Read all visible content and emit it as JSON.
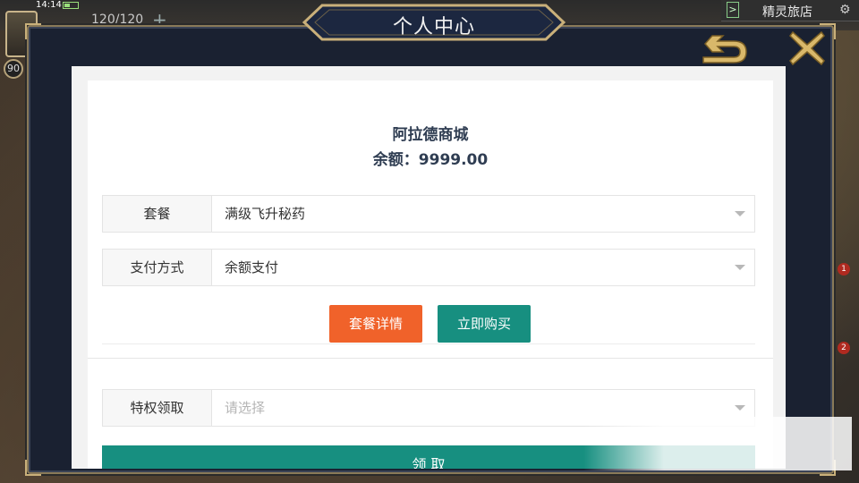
{
  "hud": {
    "time": "14:14",
    "energy": "120/120",
    "level": "90",
    "shop_label": "精灵旅店",
    "side_badge_1": "1",
    "side_badge_2": "2"
  },
  "dialog": {
    "title": "个人中心"
  },
  "shop": {
    "name": "阿拉德商城",
    "balance_label": "余额：",
    "balance_value": "9999.00"
  },
  "form": {
    "package": {
      "label": "套餐",
      "value": "满级飞升秘药"
    },
    "payment": {
      "label": "支付方式",
      "value": "余额支付"
    },
    "privilege": {
      "label": "特权领取",
      "placeholder": "请选择"
    }
  },
  "buttons": {
    "package_detail": "套餐详情",
    "buy_now": "立即购买",
    "claim": "领 取"
  },
  "colors": {
    "orange_button": "#f0622a",
    "teal_button": "#178f80",
    "dialog_bg": "#1a2131",
    "title_text": "#2f3d52"
  },
  "icons": {
    "back": "back-arrow-icon",
    "close": "close-x-icon",
    "dropdown": "caret-down-icon",
    "settings": "gear-icon"
  }
}
